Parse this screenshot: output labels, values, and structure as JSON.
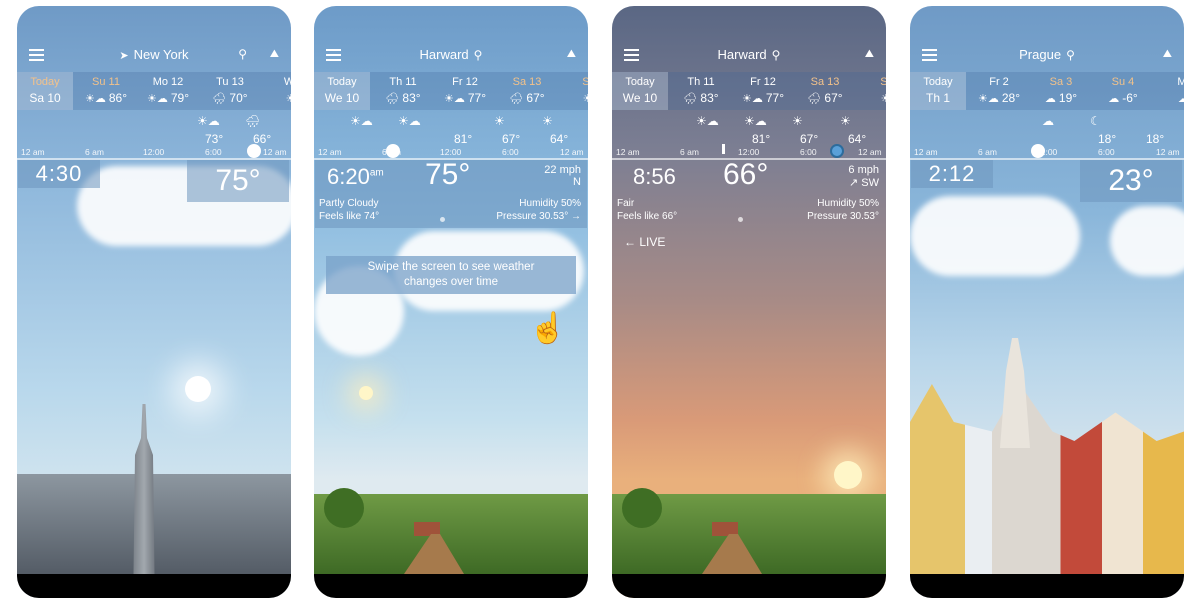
{
  "colors": {
    "highlight": "#f3c28a",
    "panel": "#6e96be"
  },
  "timeline": [
    "12 am",
    "6 am",
    "12:00",
    "6:00",
    "12 am"
  ],
  "phones": [
    {
      "city": "New York",
      "location_icon": "location-arrow-icon",
      "search_right": true,
      "days": [
        {
          "name": "Today",
          "date": "Sa 10",
          "today": true,
          "hl": true
        },
        {
          "name": "Su 11",
          "icon": "☀☁",
          "temp": "86°",
          "hl": true
        },
        {
          "name": "Mo 12",
          "icon": "☀☁",
          "temp": "79°"
        },
        {
          "name": "Tu 13",
          "icon": "🌧",
          "temp": "70°"
        },
        {
          "name": "We",
          "icon": "☀",
          "temp": ""
        }
      ],
      "hourly": [
        {
          "icon": "☀☁",
          "temp": "73°"
        },
        {
          "icon": "🌧",
          "temp": "66°"
        }
      ],
      "time": "4:30",
      "temperature": "75°"
    },
    {
      "city": "Harward",
      "days": [
        {
          "name": "Today",
          "date": "We 10",
          "today": true
        },
        {
          "name": "Th 11",
          "icon": "🌧",
          "temp": "83°"
        },
        {
          "name": "Fr 12",
          "icon": "☀☁",
          "temp": "77°"
        },
        {
          "name": "Sa 13",
          "icon": "🌧",
          "temp": "67°",
          "hl": true
        },
        {
          "name": "Su",
          "icon": "☀",
          "temp": "",
          "hl": true
        }
      ],
      "hourly": [
        {
          "icon": "☀☁",
          "temp": ""
        },
        {
          "icon": "☀☁",
          "temp": ""
        },
        {
          "icon": "",
          "temp": "81°"
        },
        {
          "icon": "☀",
          "temp": "67°"
        },
        {
          "icon": "☀",
          "temp": "64°"
        }
      ],
      "time": "6:20",
      "ampm": "am",
      "temperature": "75°",
      "wind": "22 mph",
      "wind_dir": "N",
      "condition": "Partly Cloudy",
      "feels": "Feels like 74°",
      "humidity": "Humidity 50%",
      "pressure": "Pressure 30.53° →",
      "tip": "Swipe the screen to see weather changes over time"
    },
    {
      "city": "Harward",
      "days": [
        {
          "name": "Today",
          "date": "We 10",
          "today": true
        },
        {
          "name": "Th 11",
          "icon": "🌧",
          "temp": "83°"
        },
        {
          "name": "Fr 12",
          "icon": "☀☁",
          "temp": "77°"
        },
        {
          "name": "Sa 13",
          "icon": "🌧",
          "temp": "67°",
          "hl": true
        },
        {
          "name": "Su",
          "icon": "☀",
          "temp": "",
          "hl": true
        }
      ],
      "hourly": [
        {
          "icon": "☀☁",
          "temp": ""
        },
        {
          "icon": "☀☁",
          "temp": "81°"
        },
        {
          "icon": "☀",
          "temp": "67°"
        },
        {
          "icon": "☀",
          "temp": "64°"
        }
      ],
      "time": "8:56",
      "temperature": "66°",
      "wind": "6 mph",
      "wind_dir": "↗ SW",
      "condition": "Fair",
      "feels": "Feels like 66°",
      "humidity": "Humidity 50%",
      "pressure": "Pressure 30.53°",
      "live": "← LIVE"
    },
    {
      "city": "Prague",
      "days": [
        {
          "name": "Today",
          "date": "Th 1",
          "today": true
        },
        {
          "name": "Fr 2",
          "icon": "☀☁",
          "temp": "28°"
        },
        {
          "name": "Sa 3",
          "icon": "☁",
          "temp": "19°",
          "hl": true
        },
        {
          "name": "Su 4",
          "icon": "☁",
          "temp": "-6°",
          "hl": true
        },
        {
          "name": "Mo",
          "icon": "☁",
          "temp": ""
        }
      ],
      "hourly": [
        {
          "icon": "☁",
          "temp": ""
        },
        {
          "icon": "☾",
          "temp": "18°"
        },
        {
          "icon": "",
          "temp": "18°"
        }
      ],
      "time": "2:12",
      "temperature": "23°"
    }
  ]
}
